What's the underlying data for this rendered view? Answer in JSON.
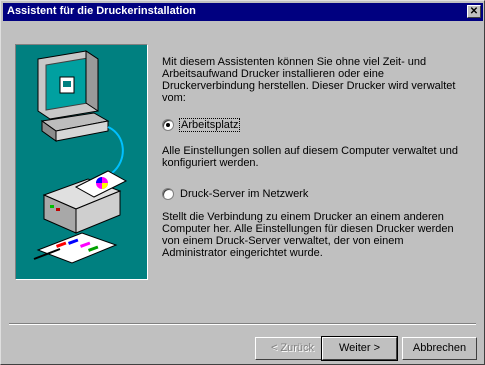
{
  "window": {
    "title": "Assistent für die Druckerinstallation",
    "close_glyph": "✕"
  },
  "intro_text": "Mit diesem Assistenten können Sie ohne viel Zeit- und Arbeitsaufwand Drucker installieren oder eine Druckerverbindung herstellen. Dieser Drucker wird verwaltet vom:",
  "options": [
    {
      "label": "Arbeitsplatz",
      "selected": true,
      "description": "Alle Einstellungen sollen auf diesem Computer verwaltet und konfiguriert werden."
    },
    {
      "label": "Druck-Server im Netzwerk",
      "selected": false,
      "description": "Stellt die Verbindung zu einem Drucker an einem anderen Computer her. Alle Einstellungen für diesen Drucker werden von einem Druck-Server verwaltet, der von einem Administrator eingerichtet wurde."
    }
  ],
  "buttons": {
    "back": "< Zurück",
    "next": "Weiter >",
    "cancel": "Abbrechen"
  },
  "colors": {
    "titlebar": "#000080",
    "art_background": "#008080",
    "face": "#c0c0c0"
  }
}
